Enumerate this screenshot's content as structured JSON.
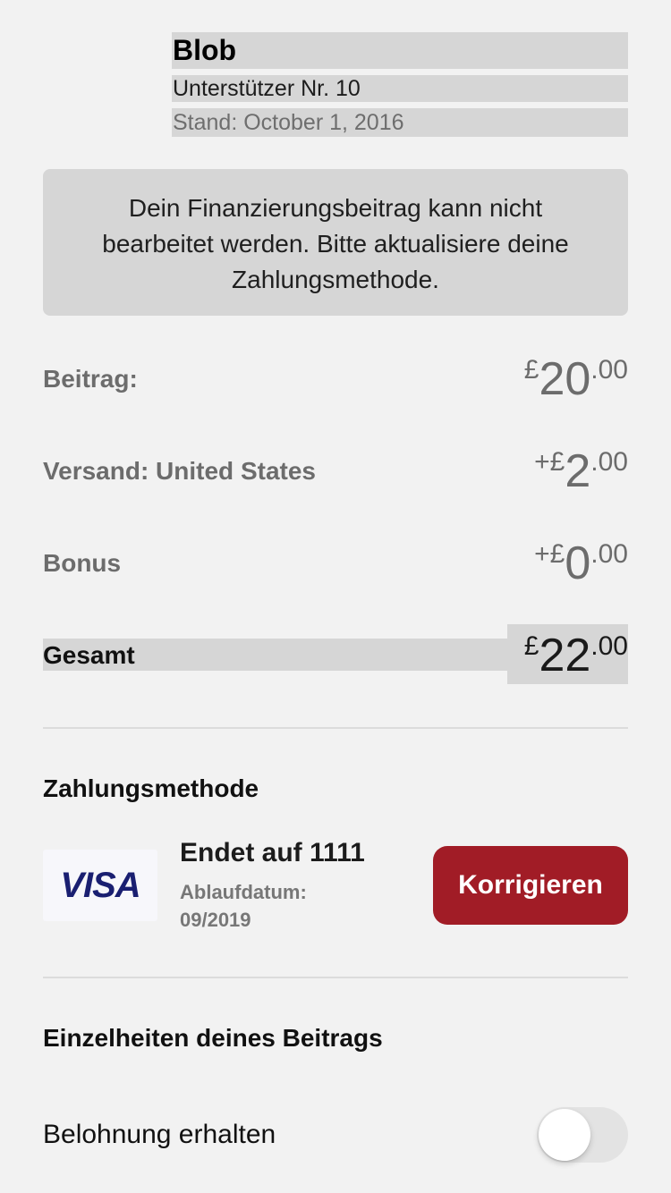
{
  "header": {
    "title": "Blob",
    "backer_number": "Unterstützer Nr. 10",
    "status_date": "Stand: October 1, 2016"
  },
  "alert": {
    "message": "Dein Finanzierungsbeitrag kann nicht bearbeitet werden. Bitte aktualisiere deine Zahlungsmethode."
  },
  "amounts": {
    "pledge": {
      "label": "Beitrag:",
      "prefix": "£",
      "whole": "20",
      "cents": ".00"
    },
    "shipping": {
      "label": "Versand: United States",
      "prefix": "+£",
      "whole": "2",
      "cents": ".00"
    },
    "bonus": {
      "label": "Bonus",
      "prefix": "+£",
      "whole": "0",
      "cents": ".00"
    },
    "total": {
      "label": "Gesamt",
      "prefix": "£",
      "whole": "22",
      "cents": ".00"
    }
  },
  "payment": {
    "section_title": "Zahlungsmethode",
    "card_brand": "VISA",
    "card_ends": "Endet auf 1111",
    "expiry_label": "Ablaufdatum:",
    "expiry_value": "09/2019",
    "fix_button": "Korrigieren",
    "button_color": "#a11c26",
    "brand_color": "#1a1f71"
  },
  "details": {
    "section_title": "Einzelheiten deines Beitrags",
    "reward_toggle_label": "Belohnung erhalten",
    "reward_toggle_on": false
  }
}
